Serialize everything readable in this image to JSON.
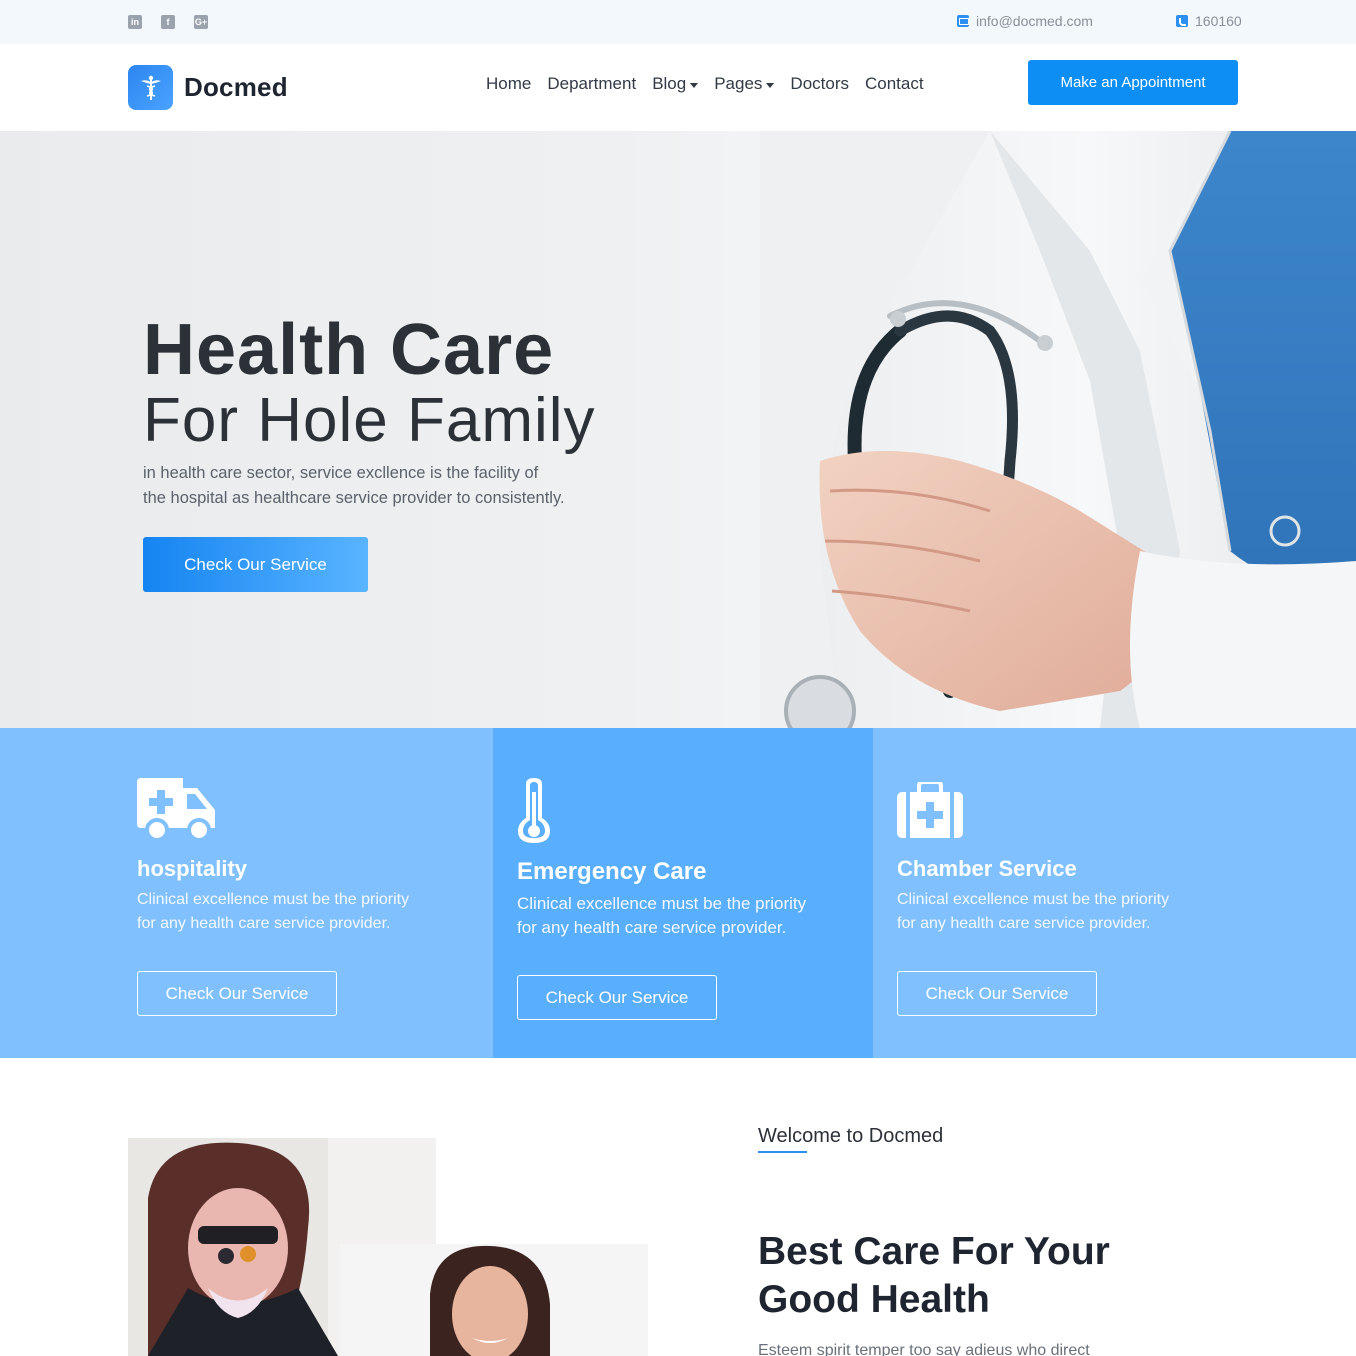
{
  "topbar": {
    "social": [
      "linkedin-icon",
      "facebook-icon",
      "google-plus-icon"
    ],
    "email": "info@docmed.com",
    "phone": "160160"
  },
  "header": {
    "brand": "Docmed",
    "nav": [
      {
        "label": "Home"
      },
      {
        "label": "Department"
      },
      {
        "label": "Blog"
      },
      {
        "label": "Pages"
      },
      {
        "label": "Doctors"
      },
      {
        "label": "Contact"
      }
    ],
    "cta_label": "Make an Appointment"
  },
  "hero": {
    "title_line1": "Health Care",
    "title_line2": "For Hole Family",
    "desc_line1": "in health care sector, service excllence is the facility of",
    "desc_line2": "the hospital as healthcare service provider to consistently.",
    "button_label": "Check Our Service"
  },
  "services": [
    {
      "icon": "ambulance-icon",
      "title": "hospitality",
      "desc_line1": "Clinical excellence must be the priority",
      "desc_line2": "for any health care service provider.",
      "button_label": "Check Our Service"
    },
    {
      "icon": "thermometer-icon",
      "title": "Emergency Care",
      "desc_line1": "Clinical excellence must be the priority",
      "desc_line2": "for any health care service provider.",
      "button_label": "Check Our Service"
    },
    {
      "icon": "first-aid-kit-icon",
      "title": "Chamber Service",
      "desc_line1": "Clinical excellence must be the priority",
      "desc_line2": "for any health care service provider.",
      "button_label": "Check Our Service"
    }
  ],
  "about": {
    "kicker": "Welcome to Docmed",
    "title_line1": "Best Care For Your",
    "title_line2": "Good Health",
    "desc": "Esteem spirit temper too say adieus who direct"
  },
  "colors": {
    "brand_blue": "#0d8ef5",
    "service_light": "#80c0fe",
    "service_mid": "#5aaefe",
    "topbar_bg": "#f3f8fd",
    "heading_dark": "#2c3138"
  }
}
